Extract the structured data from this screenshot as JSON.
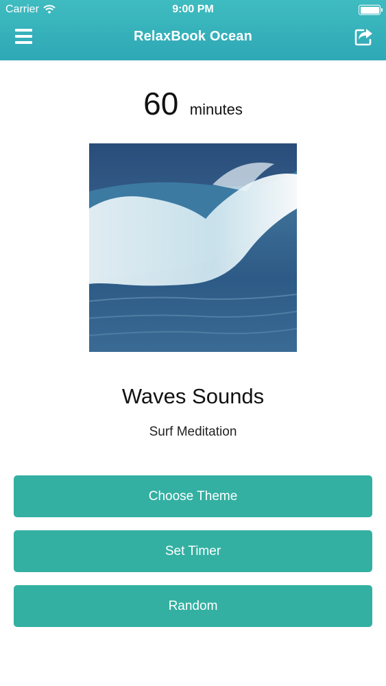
{
  "status_bar": {
    "carrier": "Carrier",
    "time": "9:00 PM"
  },
  "nav": {
    "title": "RelaxBook Ocean",
    "menu_icon": "hamburger-menu-icon",
    "share_icon": "share-icon"
  },
  "timer": {
    "value": "60",
    "unit": "minutes"
  },
  "track": {
    "title": "Waves Sounds",
    "subtitle": "Surf Meditation"
  },
  "buttons": {
    "choose_theme": "Choose Theme",
    "set_timer": "Set Timer",
    "random": "Random"
  },
  "colors": {
    "nav_background": "#35b1ba",
    "button_background": "#33b0a2",
    "button_text": "#ffffff"
  }
}
